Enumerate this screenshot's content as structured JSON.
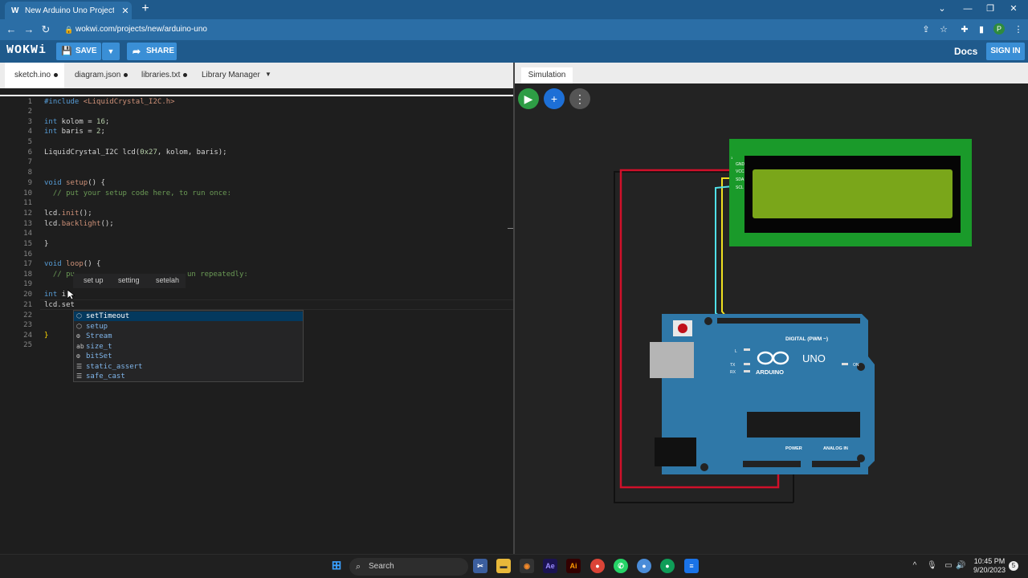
{
  "browser": {
    "tab_title": "New Arduino Uno Project - Wokwi",
    "tab_logo": "W",
    "url": "wokwi.com/projects/new/arduino-uno",
    "profile_initial": "P"
  },
  "header": {
    "brand": "WOKWi",
    "save_label": "SAVE",
    "share_label": "SHARE",
    "docs_label": "Docs",
    "signin_label": "SIGN IN"
  },
  "editor": {
    "tabs": [
      {
        "label": "sketch.ino",
        "modified": true
      },
      {
        "label": "diagram.json",
        "modified": true
      },
      {
        "label": "libraries.txt",
        "modified": true
      },
      {
        "label": "Library Manager",
        "modified": false
      }
    ],
    "line_numbers": [
      "1",
      "2",
      "3",
      "4",
      "5",
      "6",
      "7",
      "8",
      "9",
      "10",
      "11",
      "12",
      "13",
      "14",
      "15",
      "16",
      "17",
      "18",
      "19",
      "20",
      "21",
      "22",
      "23",
      "24",
      "25"
    ],
    "lines": {
      "l1_pre": "#include ",
      "l1_str": "<LiquidCrystal_I2C.h>",
      "l3_kw": "int",
      "l3_rest": " kolom = ",
      "l3_num": "16",
      "l3_end": ";",
      "l4_kw": "int",
      "l4_rest": " baris = ",
      "l4_num": "2",
      "l4_end": ";",
      "l6_ty": "LiquidCrystal_I2C",
      "l6_rest": " lcd(",
      "l6_num": "0x27",
      "l6_end": ", kolom, baris);",
      "l9_kw": "void",
      "l9_fn": " setup",
      "l9_end": "() {",
      "l10_com": "  // put your setup code here, to run once:",
      "l12_pre": "lcd.",
      "l12_fn": "init",
      "l12_end": "();",
      "l13_pre": "lcd.",
      "l13_fn": "backlight",
      "l13_end": "();",
      "l15": "}",
      "l17_kw": "void",
      "l17_fn": " loop",
      "l17_end": "() {",
      "l18_a": "  // pu",
      "l18_b": "un repeatedly:",
      "l20_kw": "int",
      "l20_rest": " i;",
      "l21": "lcd.set",
      "l24": "}"
    },
    "hint_words": [
      "set up",
      "setting",
      "setelah"
    ],
    "suggestions": [
      {
        "icon": "cube-icon",
        "match": "set",
        "rest": "Timeout"
      },
      {
        "icon": "cube-icon",
        "match": "set",
        "rest": "up"
      },
      {
        "icon": "class-icon",
        "match": "S",
        "rest": "tream"
      },
      {
        "icon": "text-icon",
        "match": "s",
        "rest": "ize_t"
      },
      {
        "icon": "class-icon",
        "match": "bit",
        "rest": "Set"
      },
      {
        "icon": "keyword-icon",
        "match": "s",
        "rest": "tatic_assert"
      },
      {
        "icon": "keyword-icon",
        "match": "s",
        "rest": "afe_cast"
      }
    ]
  },
  "simulation": {
    "tab_label": "Simulation",
    "lcd": {
      "pins": [
        "GND",
        "VCC",
        "SDA",
        "SCL"
      ],
      "header_mark": "1"
    },
    "arduino": {
      "brand": "ARDUINO",
      "model": "UNO",
      "digital_label": "DIGITAL (PWM ~)",
      "analog_label": "ANALOG IN",
      "power_label": "POWER",
      "led_labels": [
        "L",
        "TX",
        "RX",
        "ON"
      ],
      "digital_pins": [
        "AREF",
        "GND",
        "13",
        "12",
        "~11",
        "~10",
        "~9",
        "8",
        "7",
        "~6",
        "~5",
        "4",
        "~3",
        "2",
        "TX→1",
        "RX←0"
      ],
      "power_pins": [
        "IOREF",
        "RESET",
        "3.3V",
        "5V",
        "GND",
        "GND",
        "Vin"
      ],
      "analog_pins": [
        "A0",
        "A1",
        "A2",
        "A3",
        "A4",
        "A5"
      ]
    }
  },
  "taskbar": {
    "search_label": "Search",
    "time": "10:45 PM",
    "date": "9/20/2023",
    "notification_count": "5"
  },
  "colors": {
    "chrome": "#1f5a8c",
    "accent_button": "#3a8fd6",
    "play": "#2e9d45",
    "lcd_board": "#1a9a2a",
    "lcd_screen": "#7aa61a",
    "arduino_board": "#2f78a8",
    "wire_red": "#d0102a",
    "wire_black": "#111111",
    "wire_yellow": "#f0e020",
    "wire_cyan": "#50e0e8"
  }
}
